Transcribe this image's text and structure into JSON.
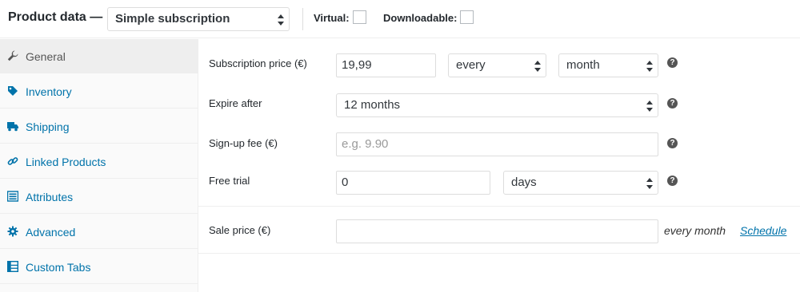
{
  "header": {
    "title": "Product data —",
    "product_type": "Simple subscription",
    "virtual_label": "Virtual:",
    "downloadable_label": "Downloadable:"
  },
  "sidebar": {
    "tabs": [
      {
        "label": "General",
        "icon": "wrench-icon",
        "active": true
      },
      {
        "label": "Inventory",
        "icon": "tag-icon",
        "active": false
      },
      {
        "label": "Shipping",
        "icon": "truck-icon",
        "active": false
      },
      {
        "label": "Linked Products",
        "icon": "link-icon",
        "active": false
      },
      {
        "label": "Attributes",
        "icon": "list-icon",
        "active": false
      },
      {
        "label": "Advanced",
        "icon": "gear-icon",
        "active": false
      },
      {
        "label": "Custom Tabs",
        "icon": "table-icon",
        "active": false
      }
    ]
  },
  "fields": {
    "subscription_price": {
      "label": "Subscription price (€)",
      "value": "19,99",
      "interval": "every",
      "period": "month"
    },
    "expire_after": {
      "label": "Expire after",
      "value": "12 months"
    },
    "signup_fee": {
      "label": "Sign-up fee (€)",
      "placeholder": "e.g. 9.90"
    },
    "free_trial": {
      "label": "Free trial",
      "value": "0",
      "period": "days"
    },
    "sale_price": {
      "label": "Sale price (€)",
      "value": "",
      "suffix": "every month",
      "schedule_link": "Schedule"
    }
  },
  "colors": {
    "link": "#0073aa",
    "active_tab_bg": "#eeeeee",
    "sidebar_bg": "#fafafa"
  }
}
